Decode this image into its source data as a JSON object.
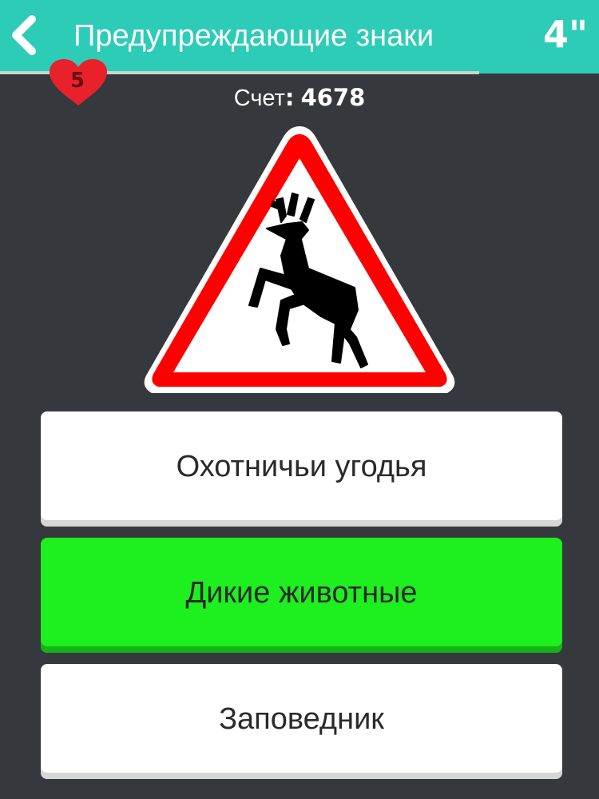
{
  "header": {
    "title": "Предупреждающие знаки",
    "timer": "4\""
  },
  "status": {
    "lives": "5",
    "score_label": "Счет",
    "score_colon": ":",
    "score_value": "4678",
    "time_progress": 0.8
  },
  "colors": {
    "header_bg": "#2dccb6",
    "background": "#35383c",
    "heart": "#e8212b",
    "answer_default": "#ffffff",
    "answer_correct": "#1eef1e",
    "sign_border": "#ff0000"
  },
  "question": {
    "sign_icon": "deer-crossing-warning-sign"
  },
  "answers": [
    {
      "label": "Охотничьи угодья",
      "state": "default"
    },
    {
      "label": "Дикие животные",
      "state": "correct"
    },
    {
      "label": "Заповедник",
      "state": "default"
    }
  ]
}
